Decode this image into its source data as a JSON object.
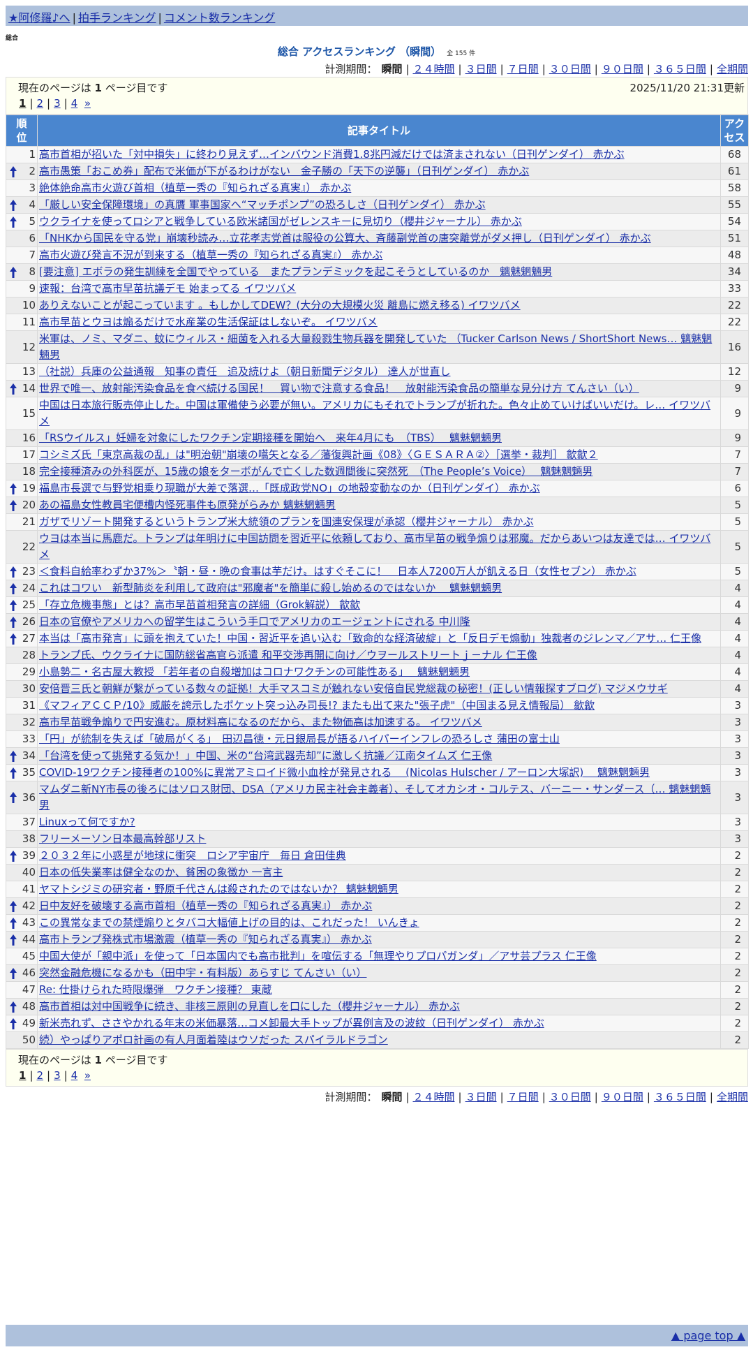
{
  "nav": {
    "links": [
      "★阿修羅♪へ",
      "拍手ランキング",
      "コメント数ランキング"
    ]
  },
  "section_label": "総合",
  "ranking_title": "総合 アクセスランキング （瞬間）",
  "total_count": "全 155 件",
  "period": {
    "label": "計測期間：",
    "current": "瞬間",
    "options": [
      "２４時間",
      "３日間",
      "７日間",
      "３０日間",
      "９０日間",
      "３６５日間",
      "全期間"
    ]
  },
  "page_info": {
    "current_text_prefix": "現在のページは",
    "current_page": "1",
    "current_text_suffix": "ページ目です",
    "updated": "2025/11/20 21:31更新",
    "pages": [
      "1",
      "2",
      "3",
      "4"
    ],
    "next": "»"
  },
  "table": {
    "headers": {
      "rank": "順位",
      "title": "記事タイトル",
      "access": "アクセス"
    },
    "rows": [
      {
        "rank": "1",
        "up": false,
        "title": "高市首相が招いた「対中損失」に終わり見えず…インバウンド消費1.8兆円減だけでは済まされない（日刊ゲンダイ） 赤かぶ",
        "count": "68"
      },
      {
        "rank": "2",
        "up": true,
        "title": "高市愚策「おこめ券」配布で米価が下がるわけがない　金子勝の「天下の逆襲」（日刊ゲンダイ） 赤かぶ",
        "count": "61"
      },
      {
        "rank": "3",
        "up": false,
        "title": "絶体絶命高市火遊び首相（植草一秀の『知られざる真実』） 赤かぶ",
        "count": "58"
      },
      {
        "rank": "4",
        "up": true,
        "title": "「厳しい安全保障環境」の真贋 軍事国家へ“マッチポンプ”の恐ろしさ（日刊ゲンダイ） 赤かぶ",
        "count": "55"
      },
      {
        "rank": "5",
        "up": true,
        "title": "ウクライナを使ってロシアと戦争している欧米諸国がゼレンスキーに見切り（櫻井ジャーナル） 赤かぶ",
        "count": "54"
      },
      {
        "rank": "6",
        "up": false,
        "title": "「NHKから国民を守る党」崩壊秒読み…立花孝志党首は服役の公算大、斉藤副党首の唐突離党がダメ押し（日刊ゲンダイ） 赤かぶ",
        "count": "51"
      },
      {
        "rank": "7",
        "up": false,
        "title": "高市火遊び発言不況が到来する（植草一秀の『知られざる真実』） 赤かぶ",
        "count": "48"
      },
      {
        "rank": "8",
        "up": true,
        "title": "[要注意] エボラの発生訓練を全国でやっている　またプランデミックを起こそうとしているのか　魑魅魍魎男",
        "count": "34"
      },
      {
        "rank": "9",
        "up": false,
        "title": "速報：台湾で高市早苗抗議デモ 始まってる イワツバメ",
        "count": "33"
      },
      {
        "rank": "10",
        "up": false,
        "title": "ありえないことが起こっています 。もしかしてDEW？(大分の大規模火災 離島に燃え移る) イワツバメ",
        "count": "22"
      },
      {
        "rank": "11",
        "up": false,
        "title": "高市早苗とウヨは煽るだけで水産業の生活保証はしないぞ。 イワツバメ",
        "count": "22"
      },
      {
        "rank": "12",
        "up": false,
        "title": "米軍は、ノミ、マダニ、蚊にウィルス・細菌を入れる大量殺戮生物兵器を開発していた （Tucker Carlson News / ShortShort News… 魑魅魍魎男",
        "count": "16"
      },
      {
        "rank": "13",
        "up": false,
        "title": "（社説）兵庫の公益通報　知事の責任　追及続けよ（朝日新聞デジタル） 達人が世直し",
        "count": "12"
      },
      {
        "rank": "14",
        "up": true,
        "title": "世界で唯一、放射能汚染食品を食べ続ける国民！　買い物で注意する食品！　放射能汚染食品の簡単な見分け方 てんさい（い）",
        "count": "9"
      },
      {
        "rank": "15",
        "up": false,
        "title": "中国は日本旅行販売停止した。中国は軍備使う必要が無い。アメリカにもそれでトランプが折れた。色々止めていけばいいだけ。レ… イワツバメ",
        "count": "9"
      },
      {
        "rank": "16",
        "up": false,
        "title": "「RSウイルス」妊婦を対象にしたワクチン定期接種を開始へ　来年4月にも　（TBS）　 魑魅魍魎男",
        "count": "9"
      },
      {
        "rank": "17",
        "up": false,
        "title": "コシミズ氏「東京高裁の乱」は\"明治朝\"崩壊の嚆矢となる／藩復興計画《08》〈ＧＥＳＡＲＡ②〉［選挙・裁判］ 歙歙２",
        "count": "7"
      },
      {
        "rank": "18",
        "up": false,
        "title": "完全接種済みの外科医が、15歳の娘をターボがんで亡くした数週間後に突然死　（The People’s Voice）　 魑魅魍魎男",
        "count": "7"
      },
      {
        "rank": "19",
        "up": true,
        "title": "福島市長選で与野党相乗り現職が大差で落選…「既成政党NO」の地殻変動なのか（日刊ゲンダイ） 赤かぶ",
        "count": "6"
      },
      {
        "rank": "20",
        "up": true,
        "title": "あの福島女性教員宅便槽内怪死事件も原発がらみか 魑魅魍魎男",
        "count": "5"
      },
      {
        "rank": "21",
        "up": false,
        "title": "ガザでリゾート開発するというトランプ米大統領のプランを国連安保理が承認（櫻井ジャーナル） 赤かぶ",
        "count": "5"
      },
      {
        "rank": "22",
        "up": false,
        "title": "ウヨは本当に馬鹿だ。トランプは年明けに中国訪問を習近平に依頼しており、高市早苗の戦争煽りは邪魔。だからあいつは友達では… イワツバメ",
        "count": "5"
      },
      {
        "rank": "23",
        "up": true,
        "title": "＜食料自給率わずか37%＞〝朝・昼・晩の食事は芋だけ〟はすぐそこに！　日本人7200万人が飢える日（女性セブン） 赤かぶ",
        "count": "5"
      },
      {
        "rank": "24",
        "up": true,
        "title": "これはコワい　新型肺炎を利用して政府は\"邪魔者\"を簡単に殺し始めるのではないか　 魑魅魍魎男",
        "count": "4"
      },
      {
        "rank": "25",
        "up": true,
        "title": "「存立危機事態」とは？高市早苗首相発言の詳細（Grok解説） 歙歙",
        "count": "4"
      },
      {
        "rank": "26",
        "up": true,
        "title": "日本の官僚やアメリカへの留学生はこういう手口でアメリカのエージェントにされる 中川隆",
        "count": "4"
      },
      {
        "rank": "27",
        "up": true,
        "title": "本当は「高市発言」に頭を抱えていた！中国・習近平を追い込む「致命的な経済破綻」と「反日デモ煽動」独裁者のジレンマ／アサ… 仁王像",
        "count": "4"
      },
      {
        "rank": "28",
        "up": false,
        "title": "トランプ氏、ウクライナに国防総省高官ら派遣 和平交渉再開に向け／ウヲールストリートｊ－ナル 仁王像",
        "count": "4"
      },
      {
        "rank": "29",
        "up": false,
        "title": "小島勢二・名古屋大教授 「若年者の自殺増加はコロナワクチンの可能性ある」　 魑魅魍魎男",
        "count": "4"
      },
      {
        "rank": "30",
        "up": false,
        "title": "安倍晋三氏と朝鮮が繋がっている数々の証拠！大手マスコミが触れない安倍自民党総裁の秘密！(正しい情報探すブログ) マジメウサギ",
        "count": "4"
      },
      {
        "rank": "31",
        "up": false,
        "title": "《マフィアＣＣＰ/10》威厳を誇示したポケット突っ込み司長!? またも出て来た\"張子虎\"（中国まる見え情報局） 歙歙",
        "count": "3"
      },
      {
        "rank": "32",
        "up": false,
        "title": "高市早苗戦争煽りで円安進む。原材料高になるのだから、また物価高は加速する。 イワツバメ",
        "count": "3"
      },
      {
        "rank": "33",
        "up": false,
        "title": "「円」が統制を失えば「破局がくる」　田辺昌徳・元日銀局長が語るハイパーインフレの恐ろしさ 蒲田の富士山",
        "count": "3"
      },
      {
        "rank": "34",
        "up": true,
        "title": "「台湾を使って挑発する気か！」中国、米の“台湾武器売却”に激しく抗議／江南タイムズ 仁王像",
        "count": "3"
      },
      {
        "rank": "35",
        "up": true,
        "title": "COVID-19ワクチン接種者の100%に異常アミロイド微小血栓が発見される　 (Nicolas Hulscher / アーロン大塚訳)　 魑魅魍魎男",
        "count": "3"
      },
      {
        "rank": "36",
        "up": true,
        "title": "マムダニ新NY市長の後ろにはソロス財団、DSA（アメリカ民主社会主義者）、そしてオカシオ・コルテス、バーニー・サンダース（… 魑魅魍魎男",
        "count": "3"
      },
      {
        "rank": "37",
        "up": false,
        "title": "Linuxって何ですか?",
        "count": "3"
      },
      {
        "rank": "38",
        "up": false,
        "title": "フリーメーソン日本最高幹部リスト",
        "count": "3"
      },
      {
        "rank": "39",
        "up": true,
        "title": "２０３２年に小惑星が地球に衝突　ロシア宇宙庁　毎日 倉田佳典",
        "count": "2"
      },
      {
        "rank": "40",
        "up": false,
        "title": "日本の低失業率は健全なのか、貧困の象徴か 一言主",
        "count": "2"
      },
      {
        "rank": "41",
        "up": false,
        "title": "ヤマトシジミの研究者・野原千代さんは殺されたのではないか？ 魑魅魍魎男",
        "count": "2"
      },
      {
        "rank": "42",
        "up": true,
        "title": "日中友好を破壊する高市首相（植草一秀の『知られざる真実』） 赤かぶ",
        "count": "2"
      },
      {
        "rank": "43",
        "up": true,
        "title": "この異常なまでの禁煙煽りとタバコ大幅値上げの目的は、これだった！ いんきょ",
        "count": "2"
      },
      {
        "rank": "44",
        "up": true,
        "title": "高市トランプ発株式市場激震（植草一秀の『知られざる真実』） 赤かぶ",
        "count": "2"
      },
      {
        "rank": "45",
        "up": false,
        "title": "中国大使が「親中派」を使って「日本国内でも高市批判」を喧伝する「無理やりプロパガンダ」／アサ芸プラス 仁王像",
        "count": "2"
      },
      {
        "rank": "46",
        "up": true,
        "title": "突然金融危機になるかも（田中宇・有料版）あらすじ てんさい（い）",
        "count": "2"
      },
      {
        "rank": "47",
        "up": false,
        "title": "Re: 仕掛けられた時限爆弾　ワクチン接種？ 東蔵",
        "count": "2"
      },
      {
        "rank": "48",
        "up": true,
        "title": "高市首相は対中国戦争に続き、非核三原則の見直しを口にした（櫻井ジャーナル） 赤かぶ",
        "count": "2"
      },
      {
        "rank": "49",
        "up": true,
        "title": "新米売れず、ささやかれる年末の米価暴落…コメ卸最大手トップが異例言及の波紋（日刊ゲンダイ） 赤かぶ",
        "count": "2"
      },
      {
        "rank": "50",
        "up": false,
        "title": "続）やっぱりアポロ計画の有人月面着陸はウソだった スパイラルドラゴン",
        "count": "2"
      }
    ]
  },
  "page_top": "▲ page top ▲",
  "colors": {
    "nav_bg": "#aec1dc",
    "header_bg": "#4a86cf",
    "link": "#1a2fa8",
    "title_color": "#1f57a8",
    "arrow": "#1a2fa8"
  }
}
